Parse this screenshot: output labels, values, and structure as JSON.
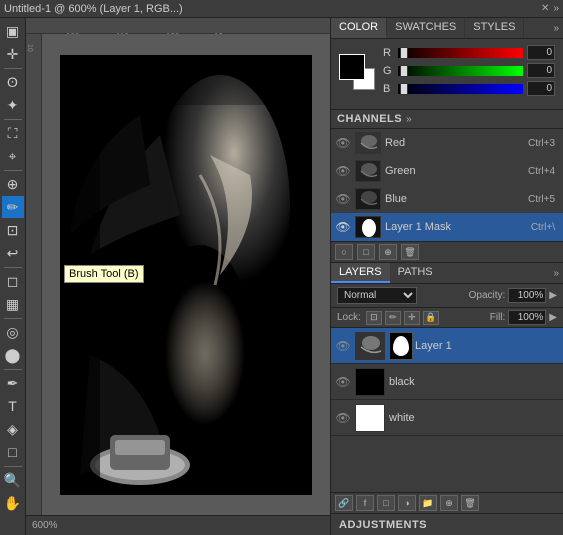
{
  "titlebar": {
    "text": "Untitled-1 @ 600% (Layer 1, RGB...)",
    "close": "✕",
    "expand": "»"
  },
  "color_panel": {
    "tabs": [
      "COLOR",
      "SWATCHES",
      "STYLES"
    ],
    "active_tab": "COLOR",
    "r_value": "0",
    "g_value": "0",
    "b_value": "0",
    "r_label": "R",
    "g_label": "G",
    "b_label": "B"
  },
  "channels_panel": {
    "title": "CHANNELS",
    "channels": [
      {
        "name": "Red",
        "shortcut": "Ctrl+3"
      },
      {
        "name": "Green",
        "shortcut": "Ctrl+4"
      },
      {
        "name": "Blue",
        "shortcut": "Ctrl+5"
      },
      {
        "name": "Layer 1 Mask",
        "shortcut": "Ctrl+\\"
      }
    ]
  },
  "layers_panel": {
    "tabs": [
      "LAYERS",
      "PATHS"
    ],
    "active_tab": "LAYERS",
    "blend_mode": "Normal",
    "opacity_label": "Opacity:",
    "opacity_value": "100%",
    "lock_label": "Lock:",
    "fill_label": "Fill:",
    "fill_value": "100%",
    "layers": [
      {
        "name": "Layer 1",
        "active": true
      },
      {
        "name": "black",
        "active": false
      },
      {
        "name": "white",
        "active": false
      }
    ]
  },
  "adjustments": {
    "title": "ADJUSTMENTS"
  },
  "canvas": {
    "zoom": "600%",
    "ruler_marks": [
      "100",
      "110",
      "120",
      "13<"
    ]
  },
  "tooltip": {
    "text": "Brush Tool (B)"
  },
  "tools": [
    {
      "icon": "▣",
      "name": "marquee"
    },
    {
      "icon": "↖",
      "name": "move"
    },
    {
      "icon": "⬡",
      "name": "lasso"
    },
    {
      "icon": "⊕",
      "name": "magic-wand"
    },
    {
      "icon": "✂",
      "name": "crop"
    },
    {
      "icon": "🔧",
      "name": "eyedropper"
    },
    {
      "icon": "⌫",
      "name": "healing"
    },
    {
      "icon": "✏",
      "name": "brush",
      "active": true
    },
    {
      "icon": "S",
      "name": "stamp"
    },
    {
      "icon": "↩",
      "name": "history"
    },
    {
      "icon": "◻",
      "name": "eraser"
    },
    {
      "icon": "🪣",
      "name": "gradient"
    },
    {
      "icon": "↔",
      "name": "blur"
    },
    {
      "icon": "⬤",
      "name": "dodge"
    },
    {
      "icon": "⬜",
      "name": "pen"
    },
    {
      "icon": "T",
      "name": "type"
    },
    {
      "icon": "◇",
      "name": "path-select"
    },
    {
      "icon": "□",
      "name": "shape"
    },
    {
      "icon": "🔍",
      "name": "zoom"
    },
    {
      "icon": "🤚",
      "name": "hand"
    }
  ]
}
